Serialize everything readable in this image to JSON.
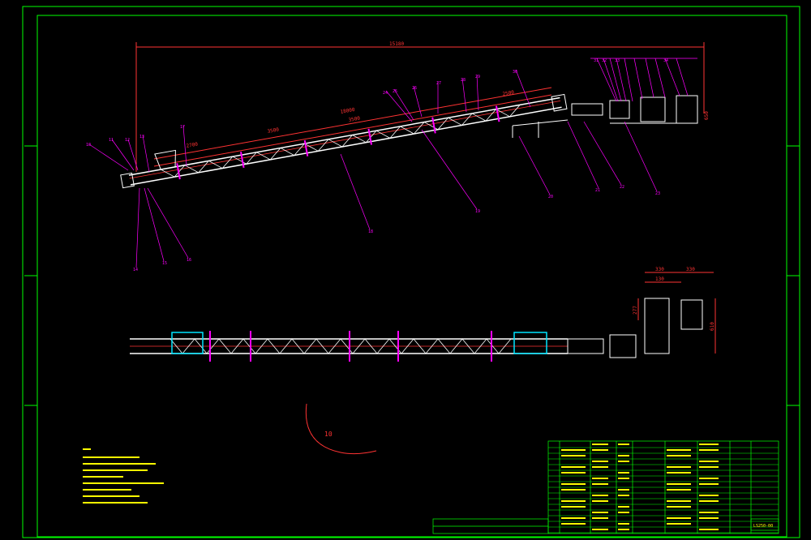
{
  "dimensions": {
    "overall_length": "15180",
    "seg_a": "2700",
    "seg_b": "3500",
    "seg_c": "18000",
    "seg_d": "3500",
    "seg_e": "2500",
    "elev": "650",
    "plan_w1": "330",
    "plan_w2": "130",
    "plan_w3": "330",
    "plan_h1": "277",
    "plan_h2": "610"
  },
  "leaders": [
    "10",
    "11",
    "12",
    "13",
    "14",
    "15",
    "16",
    "17",
    "18",
    "19",
    "20",
    "21",
    "22",
    "23",
    "24",
    "25",
    "26",
    "27",
    "28",
    "29",
    "30",
    "31",
    "32",
    "33",
    "34"
  ],
  "arc_label": "10",
  "title_code": "LS250-00",
  "colors": {
    "background": "#000000",
    "frame": "#00ff00",
    "structure": "#ffffff",
    "leader": "#ff00ff",
    "dimension": "#ff3333",
    "notes": "#ffff00",
    "highlight": "#00e5ff"
  }
}
